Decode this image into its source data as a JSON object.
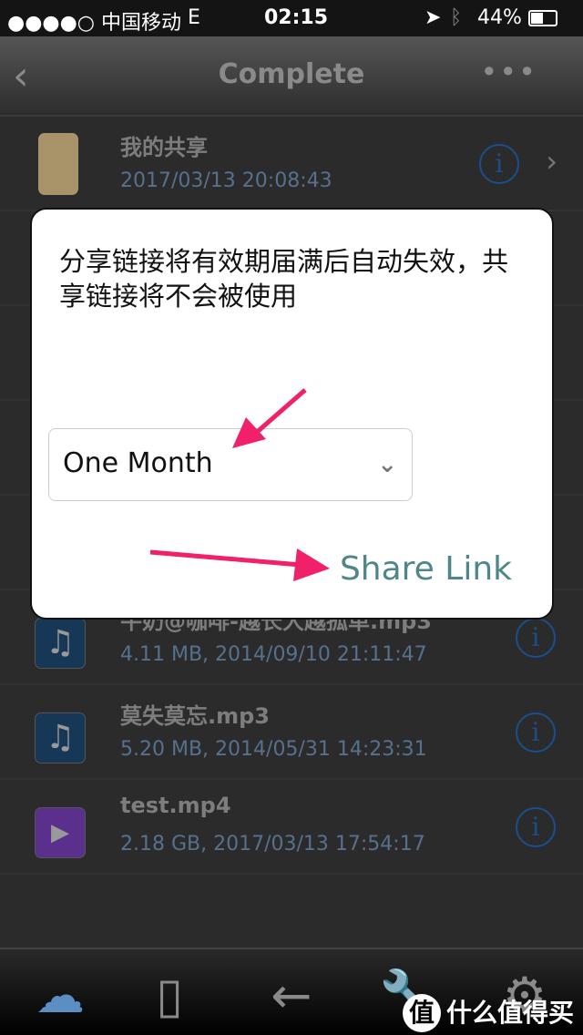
{
  "status": {
    "carrier": "●●●●○ 中国移动",
    "network": "E",
    "time": "02:15",
    "battery": "44%"
  },
  "nav": {
    "title": "Complete",
    "back": "‹",
    "more": "•••"
  },
  "rows": [
    {
      "name": "我的共享",
      "meta": "2017/03/13 20:08:43",
      "icon": "folder-icon"
    },
    {
      "name": "牛奶@咖啡-越长大越孤单.mp3",
      "meta": "4.11 MB, 2014/09/10 21:11:47",
      "icon": "music-icon"
    },
    {
      "name": "莫失莫忘.mp3",
      "meta": "5.20 MB, 2014/05/31 14:23:31",
      "icon": "music-icon"
    },
    {
      "name": "test.mp4",
      "meta": "2.18 GB, 2017/03/13 17:54:17",
      "icon": "video-icon"
    }
  ],
  "dialog": {
    "message": "分享链接将有效期届满后自动失效，共享链接将不会被使用",
    "period": "One Month",
    "share": "Share Link"
  },
  "watermark": "什么值得买",
  "colors": {
    "accent": "#4f868a",
    "arrow": "#f0206a",
    "info": "#1a4f8c"
  }
}
